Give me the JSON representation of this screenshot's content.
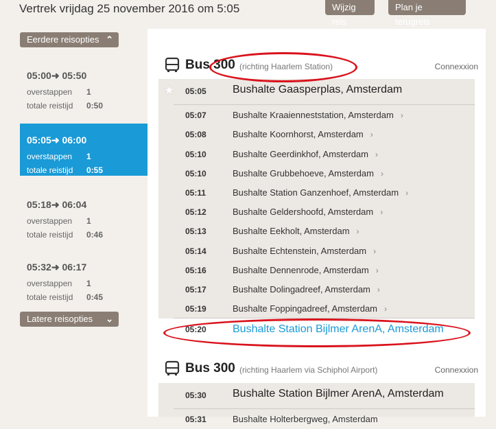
{
  "header": {
    "title": "Vertrek vrijdag 25 november 2016 om 5:05",
    "change_trip_label": "Wijzig reis",
    "plan_return_label": "Plan je terugreis"
  },
  "sidebar": {
    "earlier_label": "Eerdere reisopties",
    "later_label": "Latere reisopties",
    "options": [
      {
        "depart": "05:00",
        "arrive": "05:50",
        "transfers_label": "overstappen",
        "transfers": "1",
        "duration_label": "totale reistijd",
        "duration": "0:50"
      },
      {
        "depart": "05:05",
        "arrive": "06:00",
        "transfers_label": "overstappen",
        "transfers": "1",
        "duration_label": "totale reistijd",
        "duration": "0:55"
      },
      {
        "depart": "05:18",
        "arrive": "06:04",
        "transfers_label": "overstappen",
        "transfers": "1",
        "duration_label": "totale reistijd",
        "duration": "0:46"
      },
      {
        "depart": "05:32",
        "arrive": "06:17",
        "transfers_label": "overstappen",
        "transfers": "1",
        "duration_label": "totale reistijd",
        "duration": "0:45"
      }
    ]
  },
  "routes": [
    {
      "name": "Bus 300",
      "direction": "(richting Haarlem Station)",
      "operator": "Connexxion",
      "stops": [
        {
          "time": "05:05",
          "name": "Bushalte Gaasperplas, Amsterdam"
        },
        {
          "time": "05:07",
          "name": "Bushalte Kraaienneststation, Amsterdam"
        },
        {
          "time": "05:08",
          "name": "Bushalte Koornhorst, Amsterdam"
        },
        {
          "time": "05:10",
          "name": "Bushalte Geerdinkhof, Amsterdam"
        },
        {
          "time": "05:10",
          "name": "Bushalte Grubbehoeve, Amsterdam"
        },
        {
          "time": "05:11",
          "name": "Bushalte Station Ganzenhoef, Amsterdam"
        },
        {
          "time": "05:12",
          "name": "Bushalte Geldershoofd, Amsterdam"
        },
        {
          "time": "05:13",
          "name": "Bushalte Eekholt, Amsterdam"
        },
        {
          "time": "05:14",
          "name": "Bushalte Echtenstein, Amsterdam"
        },
        {
          "time": "05:16",
          "name": "Bushalte Dennenrode, Amsterdam"
        },
        {
          "time": "05:17",
          "name": "Bushalte Dolingadreef, Amsterdam"
        },
        {
          "time": "05:19",
          "name": "Bushalte Foppingadreef, Amsterdam"
        },
        {
          "time": "05:20",
          "name": "Bushalte Station Bijlmer ArenA, Amsterdam"
        }
      ]
    },
    {
      "name": "Bus 300",
      "direction": "(richting Haarlem via Schiphol Airport)",
      "operator": "Connexxion",
      "stops": [
        {
          "time": "05:30",
          "name": "Bushalte Station Bijlmer ArenA, Amsterdam"
        },
        {
          "time": "05:31",
          "name": "Bushalte Holterbergweg, Amsterdam"
        }
      ]
    }
  ],
  "icons": {
    "chevron": "chevron-right-icon",
    "bus": "bus-icon",
    "star": "star-icon"
  },
  "colors": {
    "accent": "#1a9ad6",
    "annotation": "#d9131d",
    "button": "#8a7e74"
  }
}
